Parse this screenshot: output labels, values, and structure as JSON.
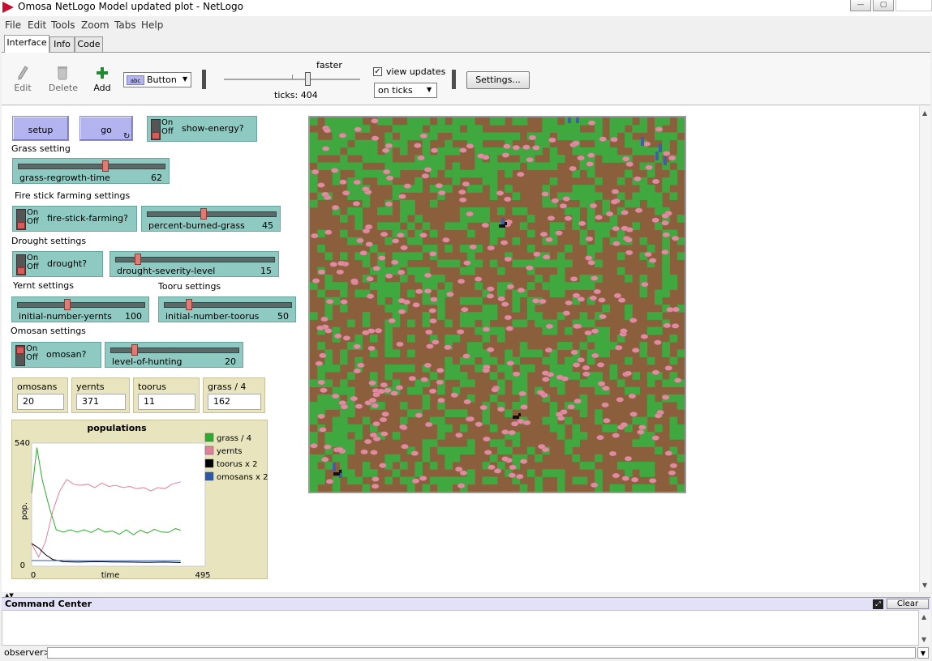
{
  "window": {
    "title": "Omosa NetLogo Model updated plot - NetLogo",
    "controls": [
      "minimize-icon",
      "maximize-icon",
      "close-icon"
    ]
  },
  "menu": [
    "File",
    "Edit",
    "Tools",
    "Zoom",
    "Tabs",
    "Help"
  ],
  "tabs": [
    {
      "label": "Interface",
      "active": true
    },
    {
      "label": "Info"
    },
    {
      "label": "Code"
    }
  ],
  "toolbar": {
    "edit_label": "Edit",
    "delete_label": "Delete",
    "add_label": "Add",
    "widget_type": "Button",
    "speed_label": "faster",
    "ticks": "ticks: 404",
    "view_updates_label": "view updates",
    "view_updates_checked": true,
    "update_mode": "on ticks",
    "settings_label": "Settings..."
  },
  "widgets": {
    "setup_label": "setup",
    "go_label": "go",
    "show_energy": {
      "label": "show-energy?",
      "on": "On",
      "off": "Off",
      "state": "off"
    },
    "grass_setting": "Grass setting",
    "grass_regrowth": {
      "label": "grass-regrowth-time",
      "value": "62",
      "fraction": 0.56
    },
    "fire_setting": "Fire stick farming settings",
    "fire_stick": {
      "label": "fire-stick-farming?",
      "on": "On",
      "off": "Off",
      "state": "off"
    },
    "percent_burned": {
      "label": "percent-burned-grass",
      "value": "45",
      "fraction": 0.45
    },
    "drought_setting": "Drought settings",
    "drought": {
      "label": "drought?",
      "on": "On",
      "off": "Off",
      "state": "off"
    },
    "drought_severity": {
      "label": "drought-severity-level",
      "value": "15",
      "fraction": 0.15
    },
    "yernt_setting": "Yernt settings",
    "tooru_setting": "Tooru settings",
    "initial_yernts": {
      "label": "initial-number-yernts",
      "value": "100",
      "fraction": 0.4
    },
    "initial_toorus": {
      "label": "initial-number-toorus",
      "value": "50",
      "fraction": 0.2
    },
    "omosan_setting": "Omosan settings",
    "omosan": {
      "label": "omosan?",
      "on": "On",
      "off": "Off",
      "state": "on"
    },
    "hunting": {
      "label": "level-of-hunting",
      "value": "20",
      "fraction": 0.2
    }
  },
  "monitors": [
    {
      "label": "omosans",
      "value": "20"
    },
    {
      "label": "yernts",
      "value": "371"
    },
    {
      "label": "toorus",
      "value": "11"
    },
    {
      "label": "grass / 4",
      "value": "162"
    }
  ],
  "chart_data": {
    "type": "line",
    "title": "populations",
    "xlabel": "time",
    "ylabel": "pop.",
    "xlim": [
      0,
      495
    ],
    "ylim": [
      0,
      540
    ],
    "x_tick_labels": [
      "0",
      "495"
    ],
    "y_tick_labels": [
      "0",
      "540"
    ],
    "legend_position": "right",
    "series": [
      {
        "name": "grass / 4",
        "color": "#2eaa2e",
        "points": [
          [
            0,
            320
          ],
          [
            15,
            520
          ],
          [
            30,
            380
          ],
          [
            50,
            260
          ],
          [
            70,
            160
          ],
          [
            90,
            150
          ],
          [
            110,
            160
          ],
          [
            130,
            150
          ],
          [
            150,
            160
          ],
          [
            170,
            148
          ],
          [
            190,
            165
          ],
          [
            210,
            150
          ],
          [
            230,
            155
          ],
          [
            250,
            140
          ],
          [
            270,
            160
          ],
          [
            290,
            138
          ],
          [
            310,
            158
          ],
          [
            330,
            145
          ],
          [
            350,
            162
          ],
          [
            370,
            150
          ],
          [
            390,
            148
          ],
          [
            410,
            165
          ],
          [
            425,
            158
          ]
        ]
      },
      {
        "name": "yernts",
        "color": "#e0819b",
        "points": [
          [
            0,
            100
          ],
          [
            20,
            40
          ],
          [
            40,
            110
          ],
          [
            60,
            240
          ],
          [
            80,
            330
          ],
          [
            100,
            380
          ],
          [
            120,
            360
          ],
          [
            140,
            355
          ],
          [
            160,
            360
          ],
          [
            180,
            345
          ],
          [
            200,
            365
          ],
          [
            220,
            350
          ],
          [
            240,
            355
          ],
          [
            260,
            345
          ],
          [
            280,
            350
          ],
          [
            300,
            340
          ],
          [
            320,
            345
          ],
          [
            340,
            330
          ],
          [
            360,
            345
          ],
          [
            380,
            340
          ],
          [
            400,
            360
          ],
          [
            425,
            370
          ]
        ]
      },
      {
        "name": "toorus x 2",
        "color": "#000000",
        "points": [
          [
            0,
            100
          ],
          [
            20,
            80
          ],
          [
            40,
            50
          ],
          [
            60,
            30
          ],
          [
            90,
            20
          ],
          [
            130,
            18
          ],
          [
            180,
            20
          ],
          [
            230,
            19
          ],
          [
            280,
            18
          ],
          [
            330,
            17
          ],
          [
            380,
            18
          ],
          [
            425,
            16
          ]
        ]
      },
      {
        "name": "omosans x 2",
        "color": "#2a5aa8",
        "points": [
          [
            0,
            25
          ],
          [
            50,
            25
          ],
          [
            100,
            25
          ],
          [
            150,
            24
          ],
          [
            200,
            24
          ],
          [
            250,
            24
          ],
          [
            300,
            24
          ],
          [
            350,
            24
          ],
          [
            400,
            24
          ],
          [
            425,
            24
          ]
        ]
      }
    ]
  },
  "colors": {
    "grass": "#3fa93f",
    "dirt": "#8b5e3c",
    "yernt": "#e08ca0",
    "omosan": "#3f5cb0",
    "tooru": "#111111"
  },
  "command_center": {
    "title": "Command Center",
    "clear_label": "Clear",
    "prompt": "observer>"
  }
}
